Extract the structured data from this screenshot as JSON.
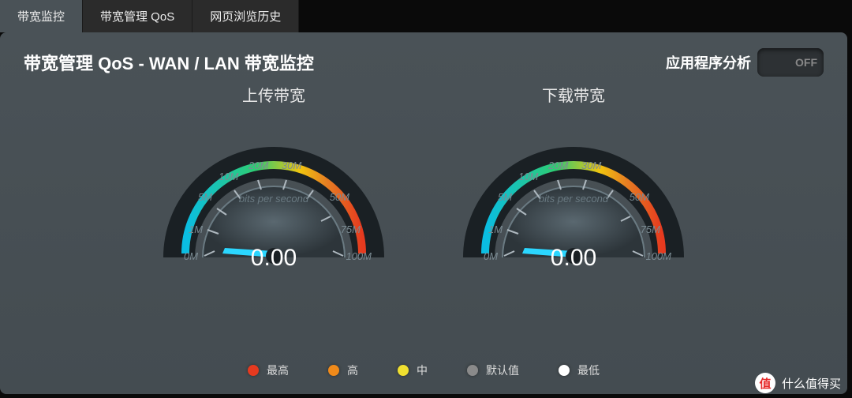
{
  "tabs": [
    {
      "label": "带宽监控",
      "active": true
    },
    {
      "label": "带宽管理 QoS",
      "active": false
    },
    {
      "label": "网页浏览历史",
      "active": false
    }
  ],
  "panel": {
    "title": "带宽管理 QoS - WAN / LAN 带宽监控",
    "toggle": {
      "label": "应用程序分析",
      "state": "OFF"
    }
  },
  "gauges": [
    {
      "title": "上传带宽",
      "value": "0.00",
      "unit": "bits per second",
      "ticks": [
        "0M",
        "1M",
        "5M",
        "10M",
        "20M",
        "30M",
        "50M",
        "75M",
        "100M"
      ]
    },
    {
      "title": "下载带宽",
      "value": "0.00",
      "unit": "bits per second",
      "ticks": [
        "0M",
        "1M",
        "5M",
        "10M",
        "20M",
        "30M",
        "50M",
        "75M",
        "100M"
      ]
    }
  ],
  "legend": [
    {
      "label": "最高",
      "color": "#e63a1f"
    },
    {
      "label": "高",
      "color": "#f08a1a"
    },
    {
      "label": "中",
      "color": "#f0e030"
    },
    {
      "label": "默认值",
      "color": "#8a8a8a"
    },
    {
      "label": "最低",
      "color": "#ffffff"
    }
  ],
  "watermark": {
    "badge": "值",
    "text": "什么值得买"
  }
}
